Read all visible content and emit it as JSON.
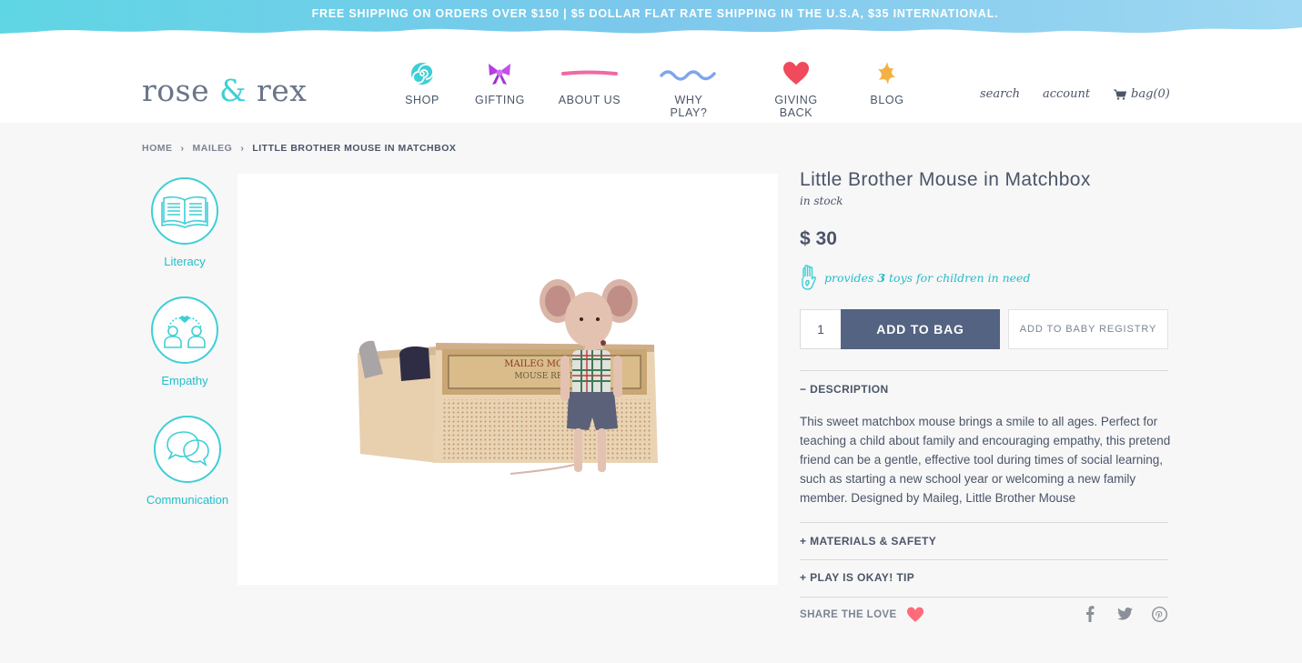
{
  "promo_banner": {
    "text": "FREE SHIPPING ON ORDERS OVER $150 | $5 DOLLAR FLAT RATE SHIPPING IN THE U.S.A, $35 INTERNATIONAL."
  },
  "header": {
    "logo": {
      "part1": "rose ",
      "amp": "&",
      "part2": " rex"
    },
    "nav": [
      {
        "label": "SHOP",
        "icon": "spiral-icon"
      },
      {
        "label": "GIFTING",
        "icon": "bow-icon"
      },
      {
        "label": "ABOUT US",
        "icon": "line-icon"
      },
      {
        "label": "WHY PLAY?",
        "icon": "wave-icon"
      },
      {
        "label": "GIVING BACK",
        "icon": "heart-icon"
      },
      {
        "label": "BLOG",
        "icon": "star-icon"
      }
    ],
    "utility": {
      "search": "search",
      "account": "account",
      "bag": "bag(0)"
    }
  },
  "breadcrumb": {
    "items": [
      "HOME",
      "MAILEG",
      "LITTLE BROTHER MOUSE IN MATCHBOX"
    ],
    "separator": "›"
  },
  "values": [
    {
      "label": "Literacy",
      "icon": "book-icon"
    },
    {
      "label": "Empathy",
      "icon": "people-heart-icon"
    },
    {
      "label": "Communication",
      "icon": "speech-bubbles-icon"
    }
  ],
  "product": {
    "title": "Little Brother Mouse in Matchbox",
    "stock": "in stock",
    "price": "$ 30",
    "provides_prefix": "provides ",
    "provides_count": "3",
    "provides_suffix": " toys for children in need",
    "quantity": "1",
    "add_to_bag": "ADD TO BAG",
    "add_to_registry": "ADD TO BABY REGISTRY"
  },
  "accordion": {
    "description_label": "− DESCRIPTION",
    "description_text": "This sweet matchbox mouse brings a smile to all ages. Perfect for teaching a child about family and encouraging empathy, this pretend friend can be a gentle, effective tool during times of social learning, such as starting a new school year or welcoming a new family member. Designed by Maileg, Little Brother Mouse",
    "materials_label": "+ MATERIALS & SAFETY",
    "tip_label": "+ PLAY IS OKAY! TIP"
  },
  "share": {
    "label": "SHARE THE LOVE",
    "icons": [
      "facebook-icon",
      "twitter-icon",
      "pinterest-icon"
    ]
  },
  "colors": {
    "accent": "#3ecfd6",
    "navy": "#536381",
    "text": "#4a5568",
    "heart": "#ff6b7a"
  }
}
